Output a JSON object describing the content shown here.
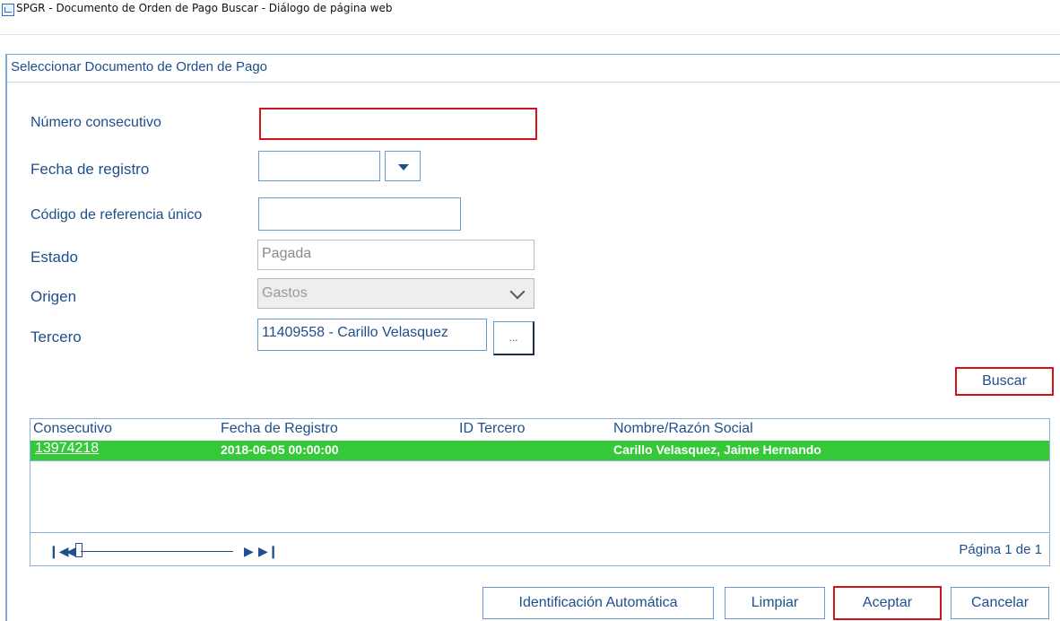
{
  "window": {
    "title": "SPGR - Documento de Orden de Pago Buscar - Diálogo de página web",
    "icon": "page-icon"
  },
  "dialog": {
    "header": "Seleccionar Documento de Orden de Pago"
  },
  "form": {
    "numero_consecutivo": {
      "label": "Número consecutivo",
      "value": ""
    },
    "fecha_registro": {
      "label": "Fecha de registro",
      "value": ""
    },
    "codigo_referencia": {
      "label": "Código de referencia único",
      "value": ""
    },
    "estado": {
      "label": "Estado",
      "value": "Pagada"
    },
    "origen": {
      "label": "Origen",
      "value": "Gastos"
    },
    "tercero": {
      "label": "Tercero",
      "value": "11409558 - Carillo Velasquez",
      "lookup_label": "..."
    }
  },
  "buttons": {
    "buscar": "Buscar",
    "identificacion": "Identificación Automática",
    "limpiar": "Limpiar",
    "aceptar": "Aceptar",
    "cancelar": "Cancelar"
  },
  "results": {
    "columns": [
      "Consecutivo",
      "Fecha de Registro",
      "ID Tercero",
      "Nombre/Razón Social"
    ],
    "rows": [
      {
        "consecutivo": "13974218",
        "fecha": "2018-06-05 00:00:00",
        "id_tercero": "",
        "nombre": "Carillo Velasquez, Jaime Hernando"
      }
    ],
    "selected_row_color": "#35c93a"
  },
  "pager": {
    "text": "Página 1 de 1",
    "icons": [
      "first-page-icon",
      "prev-page-icon",
      "next-page-icon",
      "last-page-icon"
    ]
  },
  "colors": {
    "label_blue": "#1f4e8c",
    "highlight_red": "#d4121d",
    "border_blue": "#6a9bd1"
  }
}
